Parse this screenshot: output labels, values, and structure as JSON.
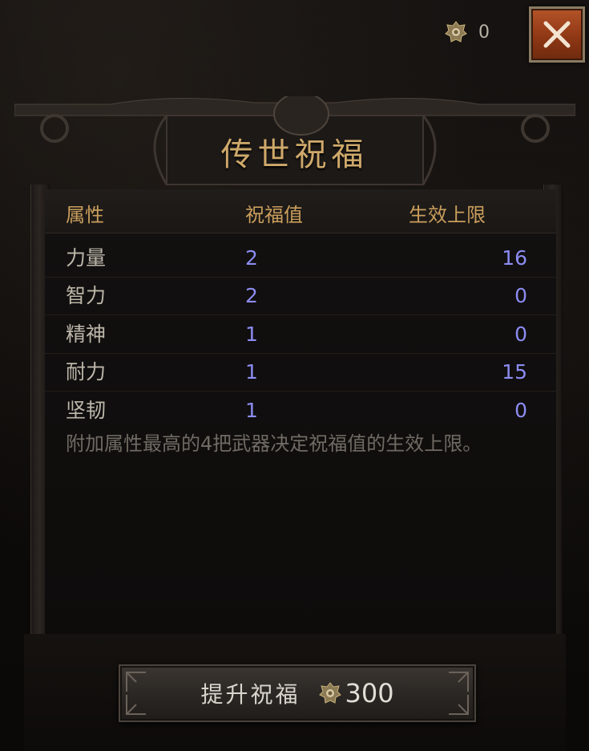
{
  "currency": {
    "icon": "blessing-gem-icon",
    "amount": "0"
  },
  "close": {
    "icon": "close-icon"
  },
  "title": "传世祝福",
  "table": {
    "headers": [
      "属性",
      "祝福值",
      "生效上限"
    ],
    "rows": [
      {
        "attribute": "力量",
        "blessing": "2",
        "limit": "16"
      },
      {
        "attribute": "智力",
        "blessing": "2",
        "limit": "0"
      },
      {
        "attribute": "精神",
        "blessing": "1",
        "limit": "0"
      },
      {
        "attribute": "耐力",
        "blessing": "1",
        "limit": "15"
      },
      {
        "attribute": "坚韧",
        "blessing": "1",
        "limit": "0"
      }
    ]
  },
  "note": "附加属性最高的4把武器决定祝福值的生效上限。",
  "upgrade": {
    "label": "提升祝福",
    "cost_icon": "blessing-gem-icon",
    "cost": "300"
  },
  "colors": {
    "title": "#cfa96b",
    "header": "#c99e5c",
    "value": "#8c8cf2",
    "close_button": "#a5461c"
  }
}
